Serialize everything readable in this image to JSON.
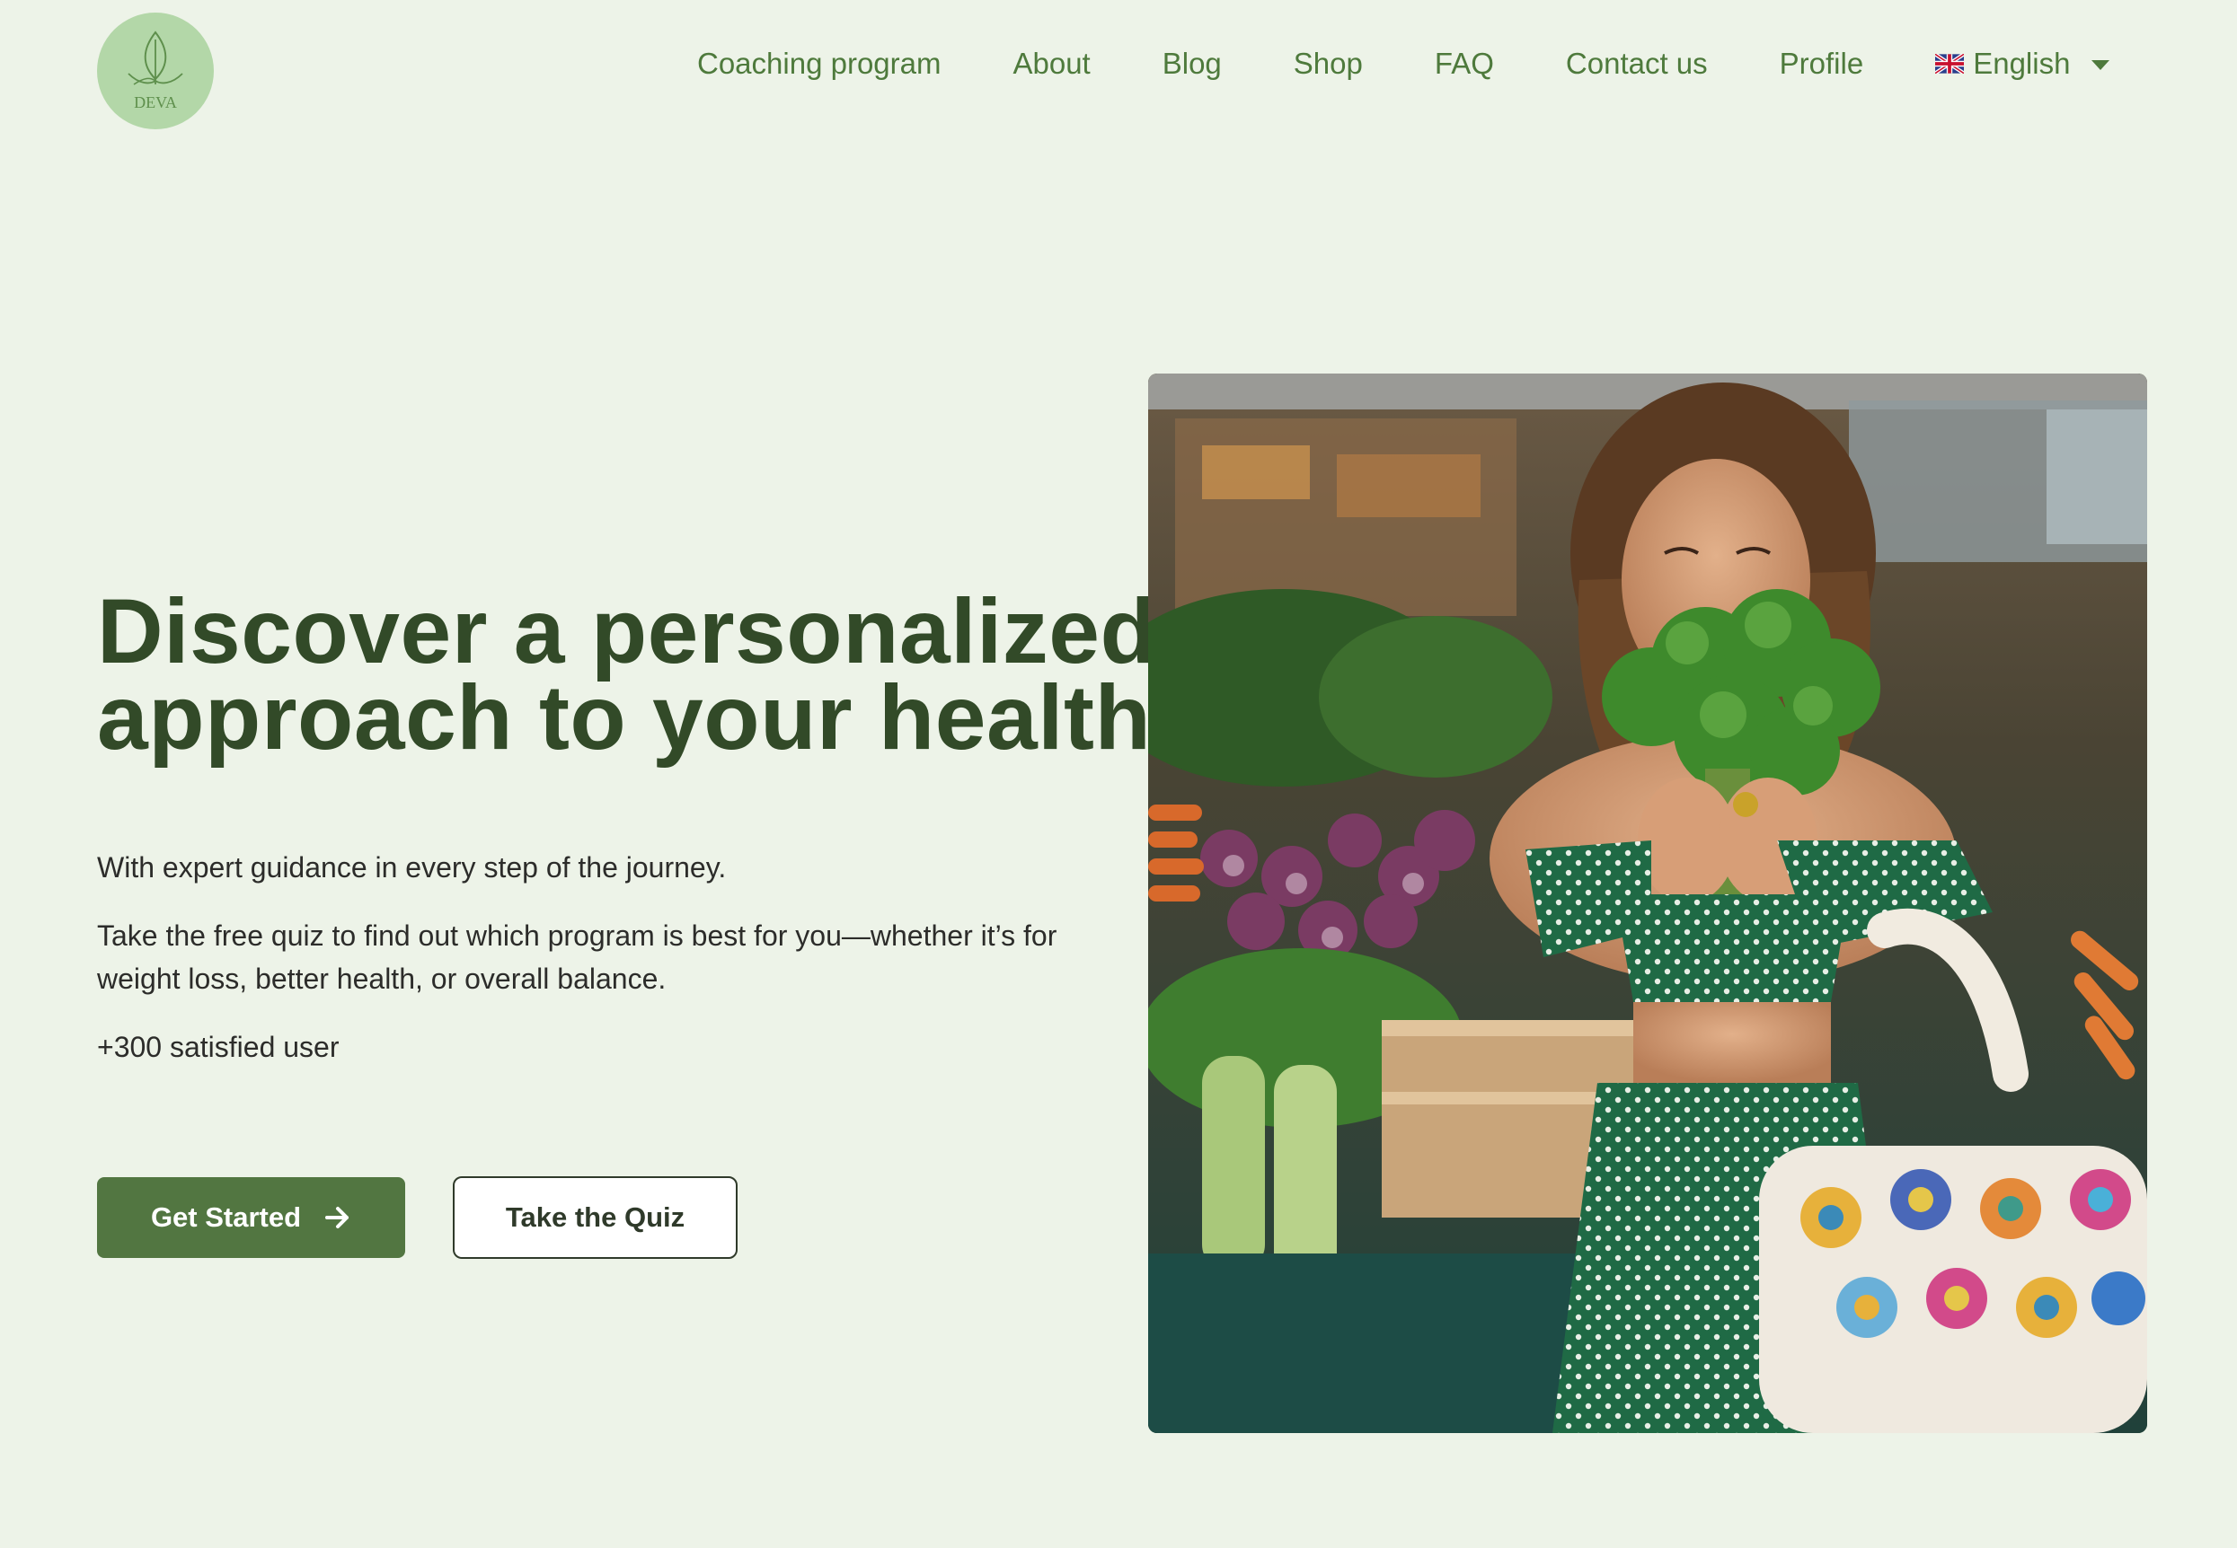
{
  "brand": {
    "logo_text": "DEVA",
    "logo_bg": "#b3d7a8",
    "accent": "#527641"
  },
  "nav": {
    "items": [
      {
        "label": "Coaching program"
      },
      {
        "label": "About"
      },
      {
        "label": "Blog"
      },
      {
        "label": "Shop"
      },
      {
        "label": "FAQ"
      },
      {
        "label": "Contact us"
      },
      {
        "label": "Profile"
      }
    ],
    "language": {
      "label": "English",
      "icon": "uk-flag-icon"
    }
  },
  "hero": {
    "title": "Discover a personalized approach to your health",
    "subtitle_1": "With expert guidance in every step of the journey.",
    "subtitle_2": "Take the free quiz to find out which program is best for you—whether it’s for weight loss, better health, or overall balance.",
    "users": "+300 satisfied user",
    "primary_button": "Get Started",
    "secondary_button": "Take the Quiz",
    "image_alt": "Woman smelling fresh herbs at a vegetable market"
  }
}
